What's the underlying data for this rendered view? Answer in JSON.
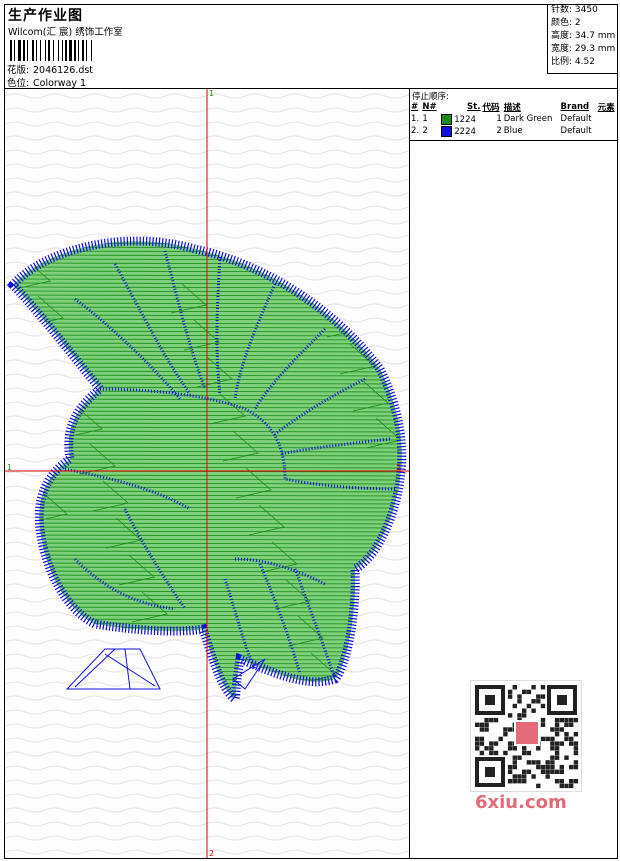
{
  "header": {
    "title": "生产作业图",
    "company": "Wilcom(汇 宸) 绣饰工作室",
    "design_label": "花版:",
    "design_value": "2046126.dst",
    "colorway_label": "色位:",
    "colorway_value": "Colorway 1"
  },
  "stats": {
    "stitches": "针数: 3450",
    "colors": "颜色: 2",
    "height": "高度: 34.7 mm",
    "width": "宽度: 29.3 mm",
    "ratio": "比例: 4.52"
  },
  "stop_sequence": {
    "title": "停止顺序:",
    "columns": [
      "#",
      "N#",
      "St.",
      "代码",
      "描述",
      "Brand",
      "元素"
    ],
    "rows": [
      {
        "idx": "1.",
        "n": "1",
        "color": "#1a8a1a",
        "st": "1224",
        "code": "1",
        "desc": "Dark Green",
        "brand": "Default"
      },
      {
        "idx": "2.",
        "n": "2",
        "color": "#1010e0",
        "st": "2224",
        "code": "2",
        "desc": "Blue",
        "brand": "Default"
      }
    ]
  },
  "axes": {
    "top_label": "1",
    "left_label": "1",
    "bottom_label": "2",
    "right_label": "2"
  },
  "watermark": "6xiu.com",
  "colors": {
    "green": "#1a8a1a",
    "blue": "#1010e0",
    "axis": "#e00000",
    "fill_green": "#7fd07a"
  }
}
